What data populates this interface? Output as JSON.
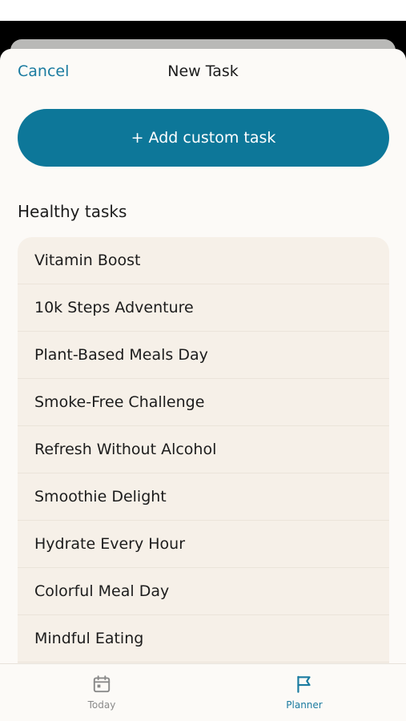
{
  "header": {
    "cancel_label": "Cancel",
    "title": "New Task"
  },
  "add_custom_task_label": "+ Add custom task",
  "section": {
    "heading": "Healthy tasks"
  },
  "tasks": [
    "Vitamin Boost",
    "10k Steps Adventure",
    "Plant-Based Meals Day",
    "Smoke-Free Challenge",
    "Refresh Without Alcohol",
    "Smoothie Delight",
    "Hydrate Every Hour",
    "Colorful Meal Day",
    "Mindful Eating"
  ],
  "tab_bar": {
    "today": {
      "label": "Today",
      "icon": "calendar-icon",
      "active": false
    },
    "planner": {
      "label": "Planner",
      "icon": "flag-icon",
      "active": true
    }
  },
  "colors": {
    "accent": "#1a7ba0",
    "primary_button": "#0d7799",
    "sheet_background": "#fcfaf7",
    "list_background": "#f6f0e8",
    "inactive_tab": "#8a8a8a"
  }
}
